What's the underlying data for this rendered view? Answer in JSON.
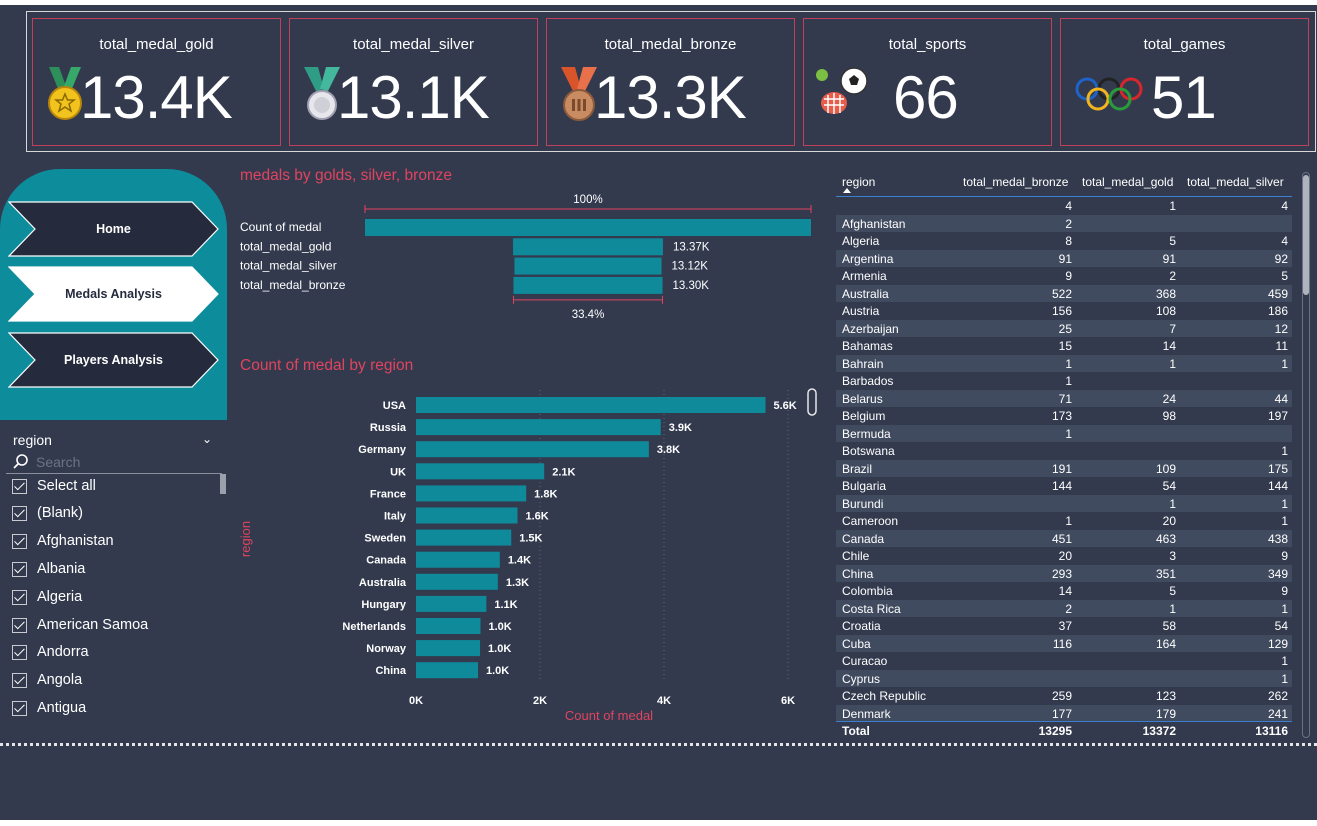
{
  "kpis": [
    {
      "title": "total_medal_gold",
      "value": "13.4K",
      "icon": "gold-medal-icon"
    },
    {
      "title": "total_medal_silver",
      "value": "13.1K",
      "icon": "silver-medal-icon"
    },
    {
      "title": "total_medal_bronze",
      "value": "13.3K",
      "icon": "bronze-medal-icon"
    },
    {
      "title": "total_sports",
      "value": "66",
      "icon": "sports-balls-icon"
    },
    {
      "title": "total_games",
      "value": "51",
      "icon": "olympic-rings-icon"
    }
  ],
  "nav": {
    "home": "Home",
    "medals": "Medals Analysis",
    "players": "Players Analysis",
    "active": "Medals Analysis"
  },
  "slicer": {
    "title": "region",
    "search_placeholder": "Search",
    "items": [
      "Select all",
      "(Blank)",
      "Afghanistan",
      "Albania",
      "Algeria",
      "American Samoa",
      "Andorra",
      "Angola",
      "Antigua"
    ]
  },
  "funnel": {
    "title": "medals by golds, silver, bronze",
    "top_pct": "100%",
    "bottom_pct": "33.4%",
    "rows": [
      {
        "label": "Count of medal",
        "value": 39783,
        "value_label": ""
      },
      {
        "label": "total_medal_gold",
        "value": 13372,
        "value_label": "13.37K"
      },
      {
        "label": "total_medal_silver",
        "value": 13116,
        "value_label": "13.12K"
      },
      {
        "label": "total_medal_bronze",
        "value": 13295,
        "value_label": "13.30K"
      }
    ]
  },
  "chart_data": {
    "type": "bar",
    "title": "Count of medal by region",
    "xlabel": "Count of medal",
    "ylabel": "region",
    "categories": [
      "USA",
      "Russia",
      "Germany",
      "UK",
      "France",
      "Italy",
      "Sweden",
      "Canada",
      "Australia",
      "Hungary",
      "Netherlands",
      "Norway",
      "China"
    ],
    "values": [
      5637,
      3947,
      3756,
      2068,
      1777,
      1637,
      1536,
      1352,
      1320,
      1135,
      1040,
      1033,
      1000
    ],
    "value_labels": [
      "5.6K",
      "3.9K",
      "3.8K",
      "2.1K",
      "1.8K",
      "1.6K",
      "1.5K",
      "1.4K",
      "1.3K",
      "1.1K",
      "1.0K",
      "1.0K",
      "1.0K"
    ],
    "xticks": [
      "0K",
      "2K",
      "4K",
      "6K"
    ],
    "xlim": [
      0,
      6000
    ]
  },
  "table": {
    "headers": [
      "region",
      "total_medal_bronze",
      "total_medal_gold",
      "total_medal_silver"
    ],
    "rows": [
      [
        "",
        "4",
        "1",
        "4"
      ],
      [
        "Afghanistan",
        "2",
        "",
        ""
      ],
      [
        "Algeria",
        "8",
        "5",
        "4"
      ],
      [
        "Argentina",
        "91",
        "91",
        "92"
      ],
      [
        "Armenia",
        "9",
        "2",
        "5"
      ],
      [
        "Australia",
        "522",
        "368",
        "459"
      ],
      [
        "Austria",
        "156",
        "108",
        "186"
      ],
      [
        "Azerbaijan",
        "25",
        "7",
        "12"
      ],
      [
        "Bahamas",
        "15",
        "14",
        "11"
      ],
      [
        "Bahrain",
        "1",
        "1",
        "1"
      ],
      [
        "Barbados",
        "1",
        "",
        ""
      ],
      [
        "Belarus",
        "71",
        "24",
        "44"
      ],
      [
        "Belgium",
        "173",
        "98",
        "197"
      ],
      [
        "Bermuda",
        "1",
        "",
        ""
      ],
      [
        "Botswana",
        "",
        "",
        "1"
      ],
      [
        "Brazil",
        "191",
        "109",
        "175"
      ],
      [
        "Bulgaria",
        "144",
        "54",
        "144"
      ],
      [
        "Burundi",
        "",
        "1",
        "1"
      ],
      [
        "Cameroon",
        "1",
        "20",
        "1"
      ],
      [
        "Canada",
        "451",
        "463",
        "438"
      ],
      [
        "Chile",
        "20",
        "3",
        "9"
      ],
      [
        "China",
        "293",
        "351",
        "349"
      ],
      [
        "Colombia",
        "14",
        "5",
        "9"
      ],
      [
        "Costa Rica",
        "2",
        "1",
        "1"
      ],
      [
        "Croatia",
        "37",
        "58",
        "54"
      ],
      [
        "Cuba",
        "116",
        "164",
        "129"
      ],
      [
        "Curacao",
        "",
        "",
        "1"
      ],
      [
        "Cyprus",
        "",
        "",
        "1"
      ],
      [
        "Czech Republic",
        "259",
        "123",
        "262"
      ],
      [
        "Denmark",
        "177",
        "179",
        "241"
      ]
    ],
    "total": [
      "Total",
      "13295",
      "13372",
      "13116"
    ]
  },
  "colors": {
    "bar": "#0f8a9b",
    "accent": "#e0445f",
    "bg": "#333a4e"
  }
}
